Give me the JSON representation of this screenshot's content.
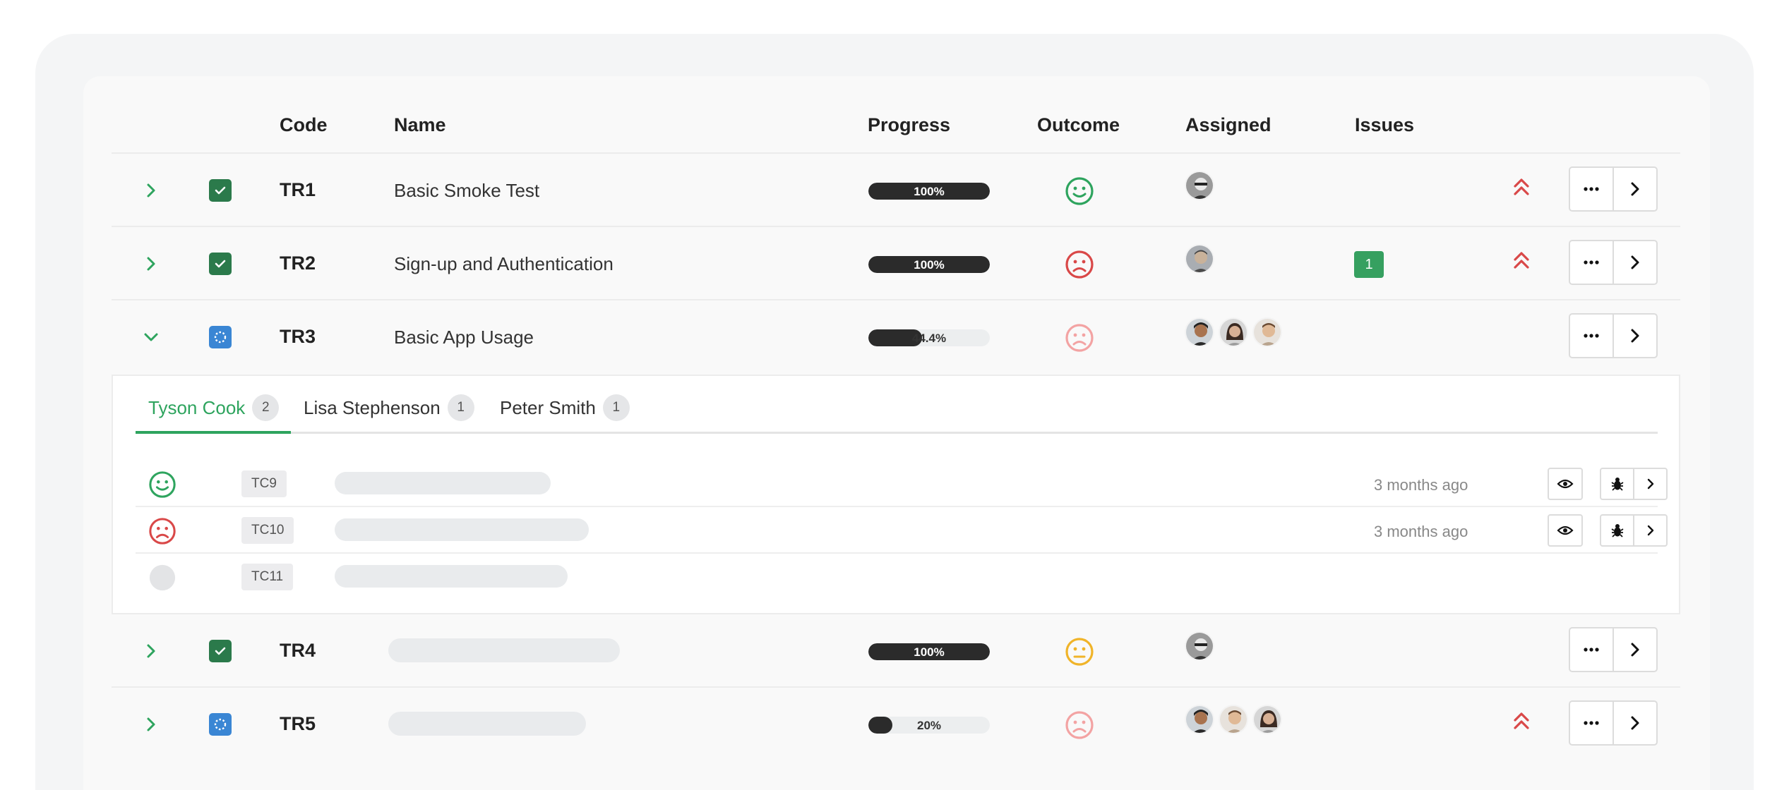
{
  "columns": {
    "code": "Code",
    "name": "Name",
    "progress": "Progress",
    "outcome": "Outcome",
    "assigned": "Assigned",
    "issues": "Issues"
  },
  "rows": [
    {
      "code": "TR1",
      "name": "Basic Smoke Test",
      "progress_label": "100%",
      "progress": 1.0,
      "outcome": "pass",
      "status": "complete",
      "issues": "",
      "priority": "high"
    },
    {
      "code": "TR2",
      "name": "Sign-up and Authentication",
      "progress_label": "100%",
      "progress": 1.0,
      "outcome": "fail",
      "status": "complete",
      "issues": "1",
      "priority": "high"
    },
    {
      "code": "TR3",
      "name": "Basic App Usage",
      "progress_label": "44.4%",
      "progress": 0.444,
      "outcome": "fail-faded",
      "status": "in-progress",
      "issues": "",
      "priority": ""
    },
    {
      "code": "TR4",
      "name": "",
      "progress_label": "100%",
      "progress": 1.0,
      "outcome": "neutral",
      "status": "complete",
      "issues": "",
      "priority": ""
    },
    {
      "code": "TR5",
      "name": "",
      "progress_label": "20%",
      "progress": 0.2,
      "outcome": "fail-faded",
      "status": "in-progress",
      "issues": "",
      "priority": "high"
    }
  ],
  "tabs": [
    {
      "label": "Tyson Cook",
      "count": "2"
    },
    {
      "label": "Lisa Stephenson",
      "count": "1"
    },
    {
      "label": "Peter Smith",
      "count": "1"
    }
  ],
  "test_cases": [
    {
      "code": "TC9",
      "time": "3 months ago",
      "outcome": "pass"
    },
    {
      "code": "TC10",
      "time": "3 months ago",
      "outcome": "fail"
    },
    {
      "code": "TC11",
      "time": "",
      "outcome": "untested"
    }
  ],
  "colors": {
    "accent": "#2ea45e",
    "fail": "#d94848",
    "neutral": "#f0b429",
    "checkbox_done": "#2b7a4b",
    "checkbox_progress": "#3a86d4"
  }
}
